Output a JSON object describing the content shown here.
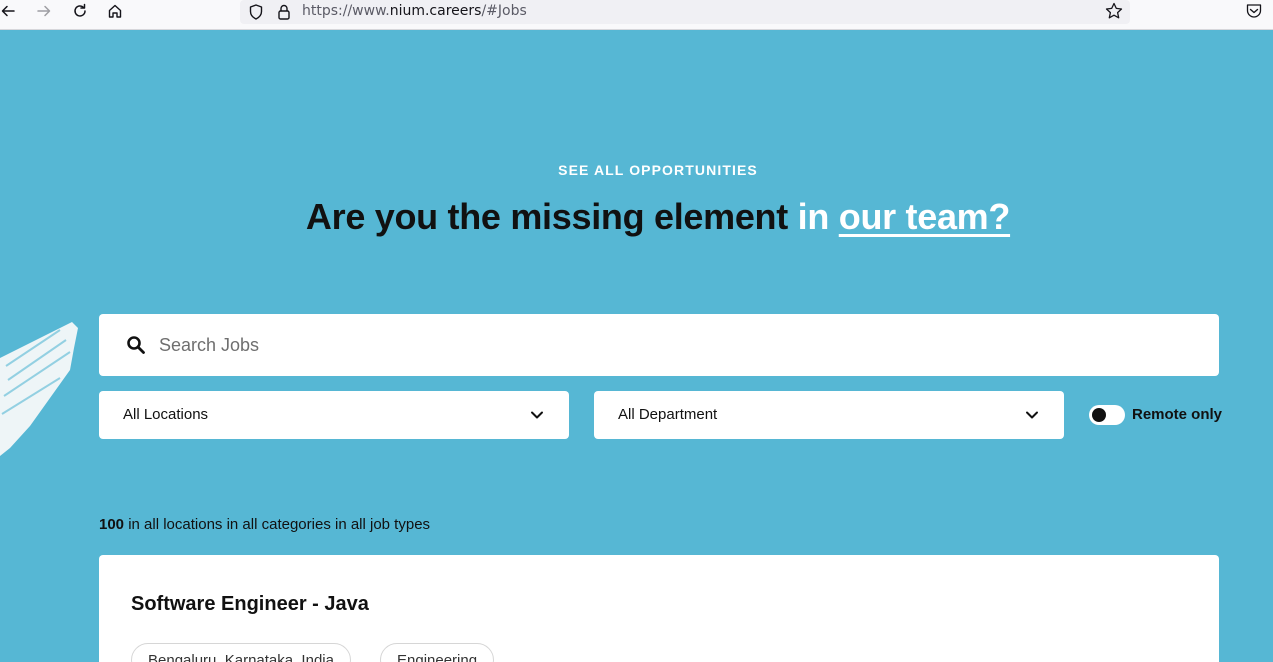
{
  "browser": {
    "url_prefix": "https://www.",
    "url_domain": "nium.careers",
    "url_suffix": "/#Jobs"
  },
  "hero": {
    "eyebrow": "SEE ALL OPPORTUNITIES",
    "headline_dark": "Are you the missing element",
    "headline_in": "in",
    "headline_link": "our team?"
  },
  "search": {
    "placeholder": "Search Jobs"
  },
  "filters": {
    "location_label": "All Locations",
    "department_label": "All Department",
    "remote_label": "Remote only",
    "remote_on": false
  },
  "results": {
    "count": "100",
    "summary": "in all locations in all categories in all job types"
  },
  "jobs": [
    {
      "title": "Software Engineer - Java",
      "location": "Bengaluru, Karnataka, India",
      "department": "Engineering"
    }
  ]
}
